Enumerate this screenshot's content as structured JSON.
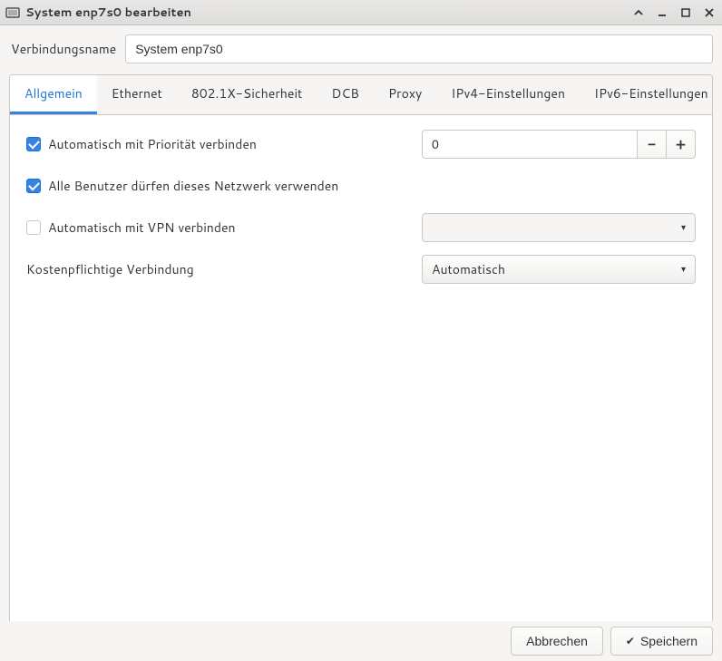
{
  "titlebar": {
    "title": "System enp7s0 bearbeiten"
  },
  "connection": {
    "name_label": "Verbindungsname",
    "name_value": "System enp7s0"
  },
  "tabs": [
    {
      "label": "Allgemein"
    },
    {
      "label": "Ethernet"
    },
    {
      "label": "802.1X-Sicherheit"
    },
    {
      "label": "DCB"
    },
    {
      "label": "Proxy"
    },
    {
      "label": "IPv4-Einstellungen"
    },
    {
      "label": "IPv6-Einstellungen"
    }
  ],
  "general": {
    "auto_priority_label": "Automatisch mit Priorität verbinden",
    "priority_value": "0",
    "all_users_label": "Alle Benutzer dürfen dieses Netzwerk verwenden",
    "auto_vpn_label": "Automatisch mit VPN verbinden",
    "vpn_value": "",
    "metered_label": "Kostenpflichtige Verbindung",
    "metered_value": "Automatisch"
  },
  "footer": {
    "cancel_label": "Abbrechen",
    "save_label": "Speichern"
  }
}
